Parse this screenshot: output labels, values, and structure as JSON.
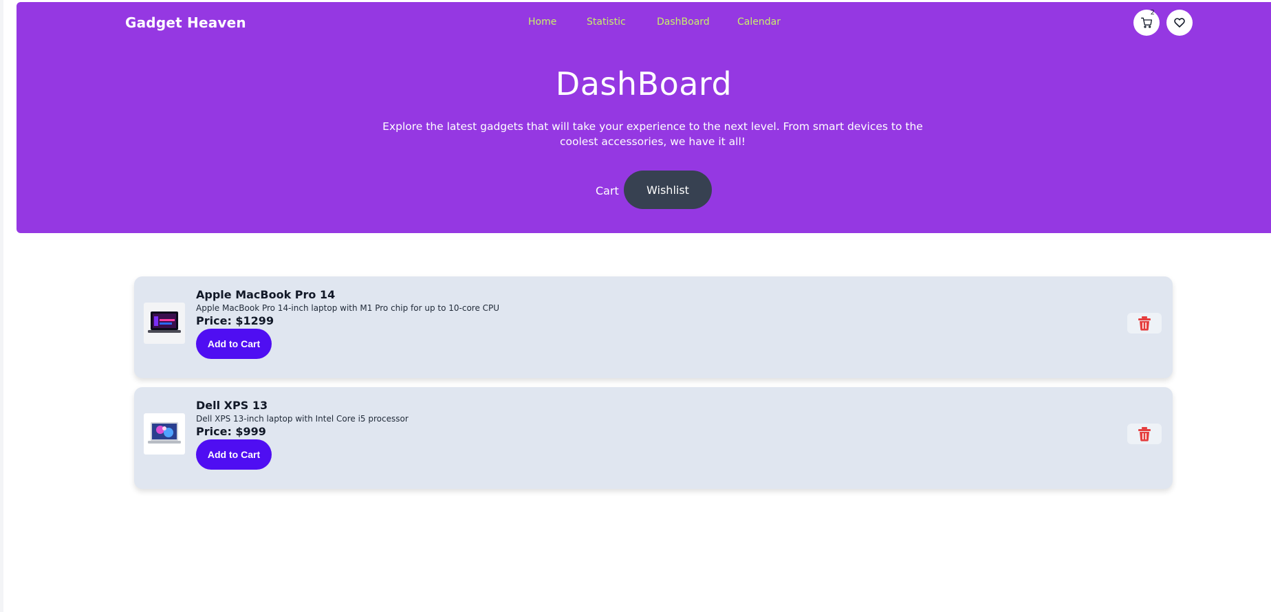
{
  "header": {
    "brand": "Gadget Heaven",
    "nav": [
      "Home",
      "Statistic",
      "DashBoard",
      "Calendar"
    ],
    "cart_count": "2"
  },
  "hero": {
    "title": "DashBoard",
    "subtitle": "Explore the latest gadgets that will take your experience to the next level. From smart devices to the coolest accessories, we have it all!",
    "tabs": {
      "cart": "Cart",
      "wishlist": "Wishlist"
    }
  },
  "wishlist": [
    {
      "name": "Apple MacBook Pro 14",
      "description": "Apple MacBook Pro 14-inch laptop with M1 Pro chip for up to 10-core CPU",
      "price": "Price: $1299",
      "button": "Add to Cart"
    },
    {
      "name": "Dell XPS 13",
      "description": "Dell XPS 13-inch laptop with Intel Core i5 processor",
      "price": "Price: $999",
      "button": "Add to Cart"
    }
  ],
  "colors": {
    "brand_purple": "#9538e2",
    "nav_link": "#c9f06a",
    "active_tab": "#374151",
    "cta": "#4f0ef2",
    "delete": "#e53e3e"
  },
  "icons": {
    "cart": "cart-icon",
    "wishlist": "heart-icon",
    "delete": "trash-icon"
  }
}
